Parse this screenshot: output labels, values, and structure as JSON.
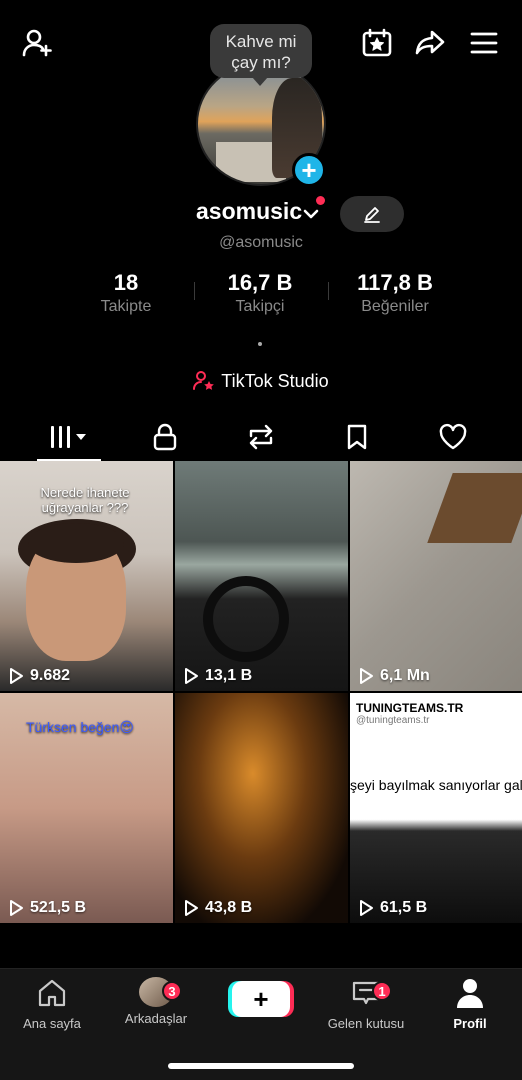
{
  "profile": {
    "note": "Kahve mi çay mı?",
    "username": "asomusic",
    "handle": "@asomusic"
  },
  "stats": [
    {
      "value": "18",
      "label": "Takipte"
    },
    {
      "value": "16,7 B",
      "label": "Takipçi"
    },
    {
      "value": "117,8 B",
      "label": "Beğeniler"
    }
  ],
  "studio_label": "TikTok Studio",
  "icons": {
    "add_friend": "add-user-icon",
    "calendar": "calendar-star-icon",
    "share": "share-icon",
    "menu": "hamburger-menu-icon"
  },
  "tabs": [
    "videos",
    "private",
    "reposts",
    "saved",
    "liked"
  ],
  "videos": [
    {
      "views": "9.682",
      "caption": "Nerede ihanete uğrayanlar ???"
    },
    {
      "views": "13,1 B"
    },
    {
      "views": "6,1 Mn"
    },
    {
      "views": "521,5 B",
      "caption": "Türksen beğen😍"
    },
    {
      "views": "43,8 B"
    },
    {
      "views": "61,5 B",
      "brand": "TUNINGTEAMS.TR",
      "brand_handle": "@tuningteams.tr",
      "caption": "şeyi bayılmak sanıyorlar galiba"
    }
  ],
  "nav": {
    "home": "Ana sayfa",
    "friends": "Arkadaşlar",
    "friends_badge": "3",
    "inbox": "Gelen kutusu",
    "inbox_badge": "1",
    "profile": "Profil"
  },
  "colors": {
    "accent": "#1fb5e8",
    "badge": "#fe2c55"
  }
}
